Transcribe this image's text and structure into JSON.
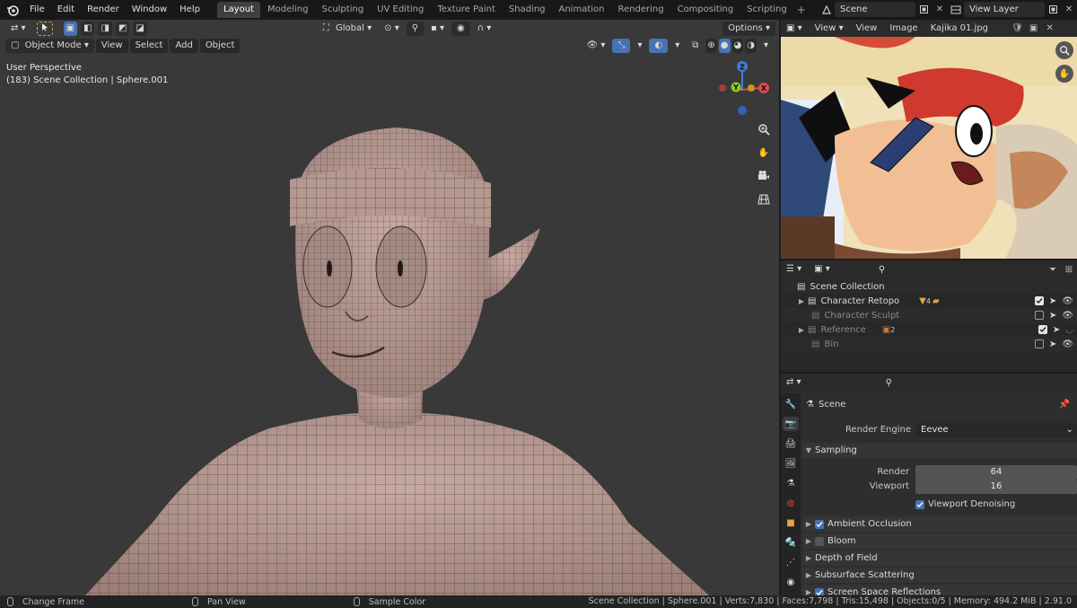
{
  "menu": [
    "File",
    "Edit",
    "Render",
    "Window",
    "Help"
  ],
  "workspaces": [
    "Layout",
    "Modeling",
    "Sculpting",
    "UV Editing",
    "Texture Paint",
    "Shading",
    "Animation",
    "Rendering",
    "Compositing",
    "Scripting"
  ],
  "active_workspace": "Layout",
  "scene_field": "Scene",
  "view_layer_field": "View Layer",
  "viewport": {
    "mode": "Object Mode",
    "menus": [
      "View",
      "Select",
      "Add",
      "Object"
    ],
    "transform_orientation": "Global",
    "options": "Options",
    "info_line1": "User Perspective",
    "info_line2": "(183) Scene Collection | Sphere.001",
    "gizmo": {
      "z": "Z",
      "y": "Y",
      "x": "X"
    }
  },
  "image_editor": {
    "menus": [
      "View",
      "Image"
    ],
    "image_name": "Kajika 01.jpg",
    "view_button": "View"
  },
  "outliner": {
    "root": "Scene Collection",
    "items": [
      {
        "label": "Character Retopo",
        "enabled": true,
        "expandable": true,
        "modifier_count": "4"
      },
      {
        "label": "Character Sculpt",
        "enabled": false,
        "expandable": false
      },
      {
        "label": "Reference",
        "enabled": true,
        "expandable": true,
        "object_count": "2"
      },
      {
        "label": "Bin",
        "enabled": false,
        "expandable": false
      }
    ]
  },
  "properties": {
    "context": "Scene",
    "render_engine_label": "Render Engine",
    "render_engine": "Eevee",
    "sampling_label": "Sampling",
    "render_label": "Render",
    "render_samples": "64",
    "viewport_label": "Viewport",
    "viewport_samples": "16",
    "denoise_label": "Viewport Denoising",
    "panels": [
      {
        "label": "Ambient Occlusion",
        "checkbox": "on"
      },
      {
        "label": "Bloom",
        "checkbox": "off"
      },
      {
        "label": "Depth of Field",
        "checkbox": "none"
      },
      {
        "label": "Subsurface Scattering",
        "checkbox": "none"
      },
      {
        "label": "Screen Space Reflections",
        "checkbox": "on"
      }
    ]
  },
  "status": {
    "left": "Change Frame",
    "middle": "Pan View",
    "right": "Sample Color",
    "stats": "Scene Collection | Sphere.001 | Verts:7,830 | Faces:7,798 | Tris:15,498 | Objects:0/5 | Memory: 494.2 MiB | 2.91.0"
  },
  "colors": {
    "accent": "#4772b3",
    "viewport_bg": "#393939",
    "mesh": "#b59a93",
    "axis_x": "#e0474f",
    "axis_y": "#8fc629",
    "axis_z": "#3e7ddb"
  }
}
